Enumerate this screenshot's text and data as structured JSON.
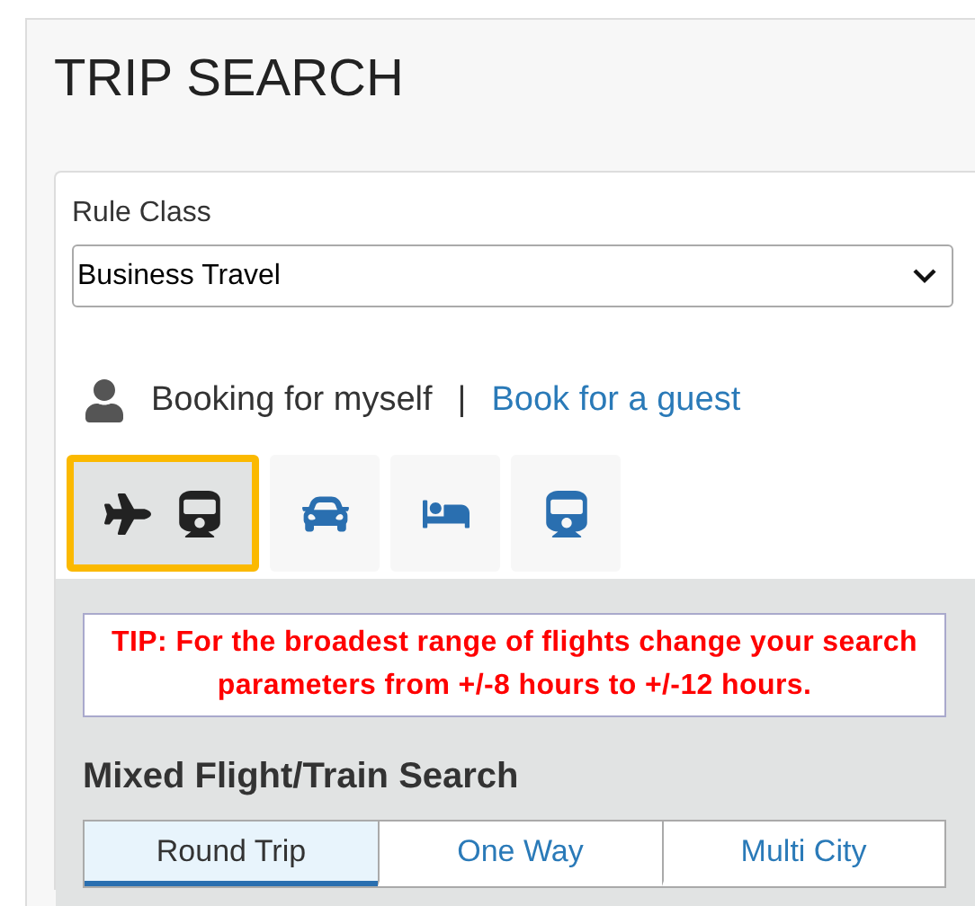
{
  "title": "TRIP SEARCH",
  "rule_class": {
    "label": "Rule Class",
    "value": "Business Travel"
  },
  "booking": {
    "self_label": "Booking for myself",
    "separator": "|",
    "guest_link": "Book for a guest"
  },
  "mode_tabs": [
    {
      "kind": "flight-train",
      "selected": true
    },
    {
      "kind": "car",
      "selected": false
    },
    {
      "kind": "hotel",
      "selected": false
    },
    {
      "kind": "train",
      "selected": false
    }
  ],
  "tip": "TIP: For the broadest range of flights change your search parameters from +/-8 hours to +/-12 hours.",
  "section_title": "Mixed Flight/Train Search",
  "trip_types": [
    {
      "label": "Round Trip",
      "selected": true
    },
    {
      "label": "One Way",
      "selected": false
    },
    {
      "label": "Multi City",
      "selected": false
    }
  ]
}
